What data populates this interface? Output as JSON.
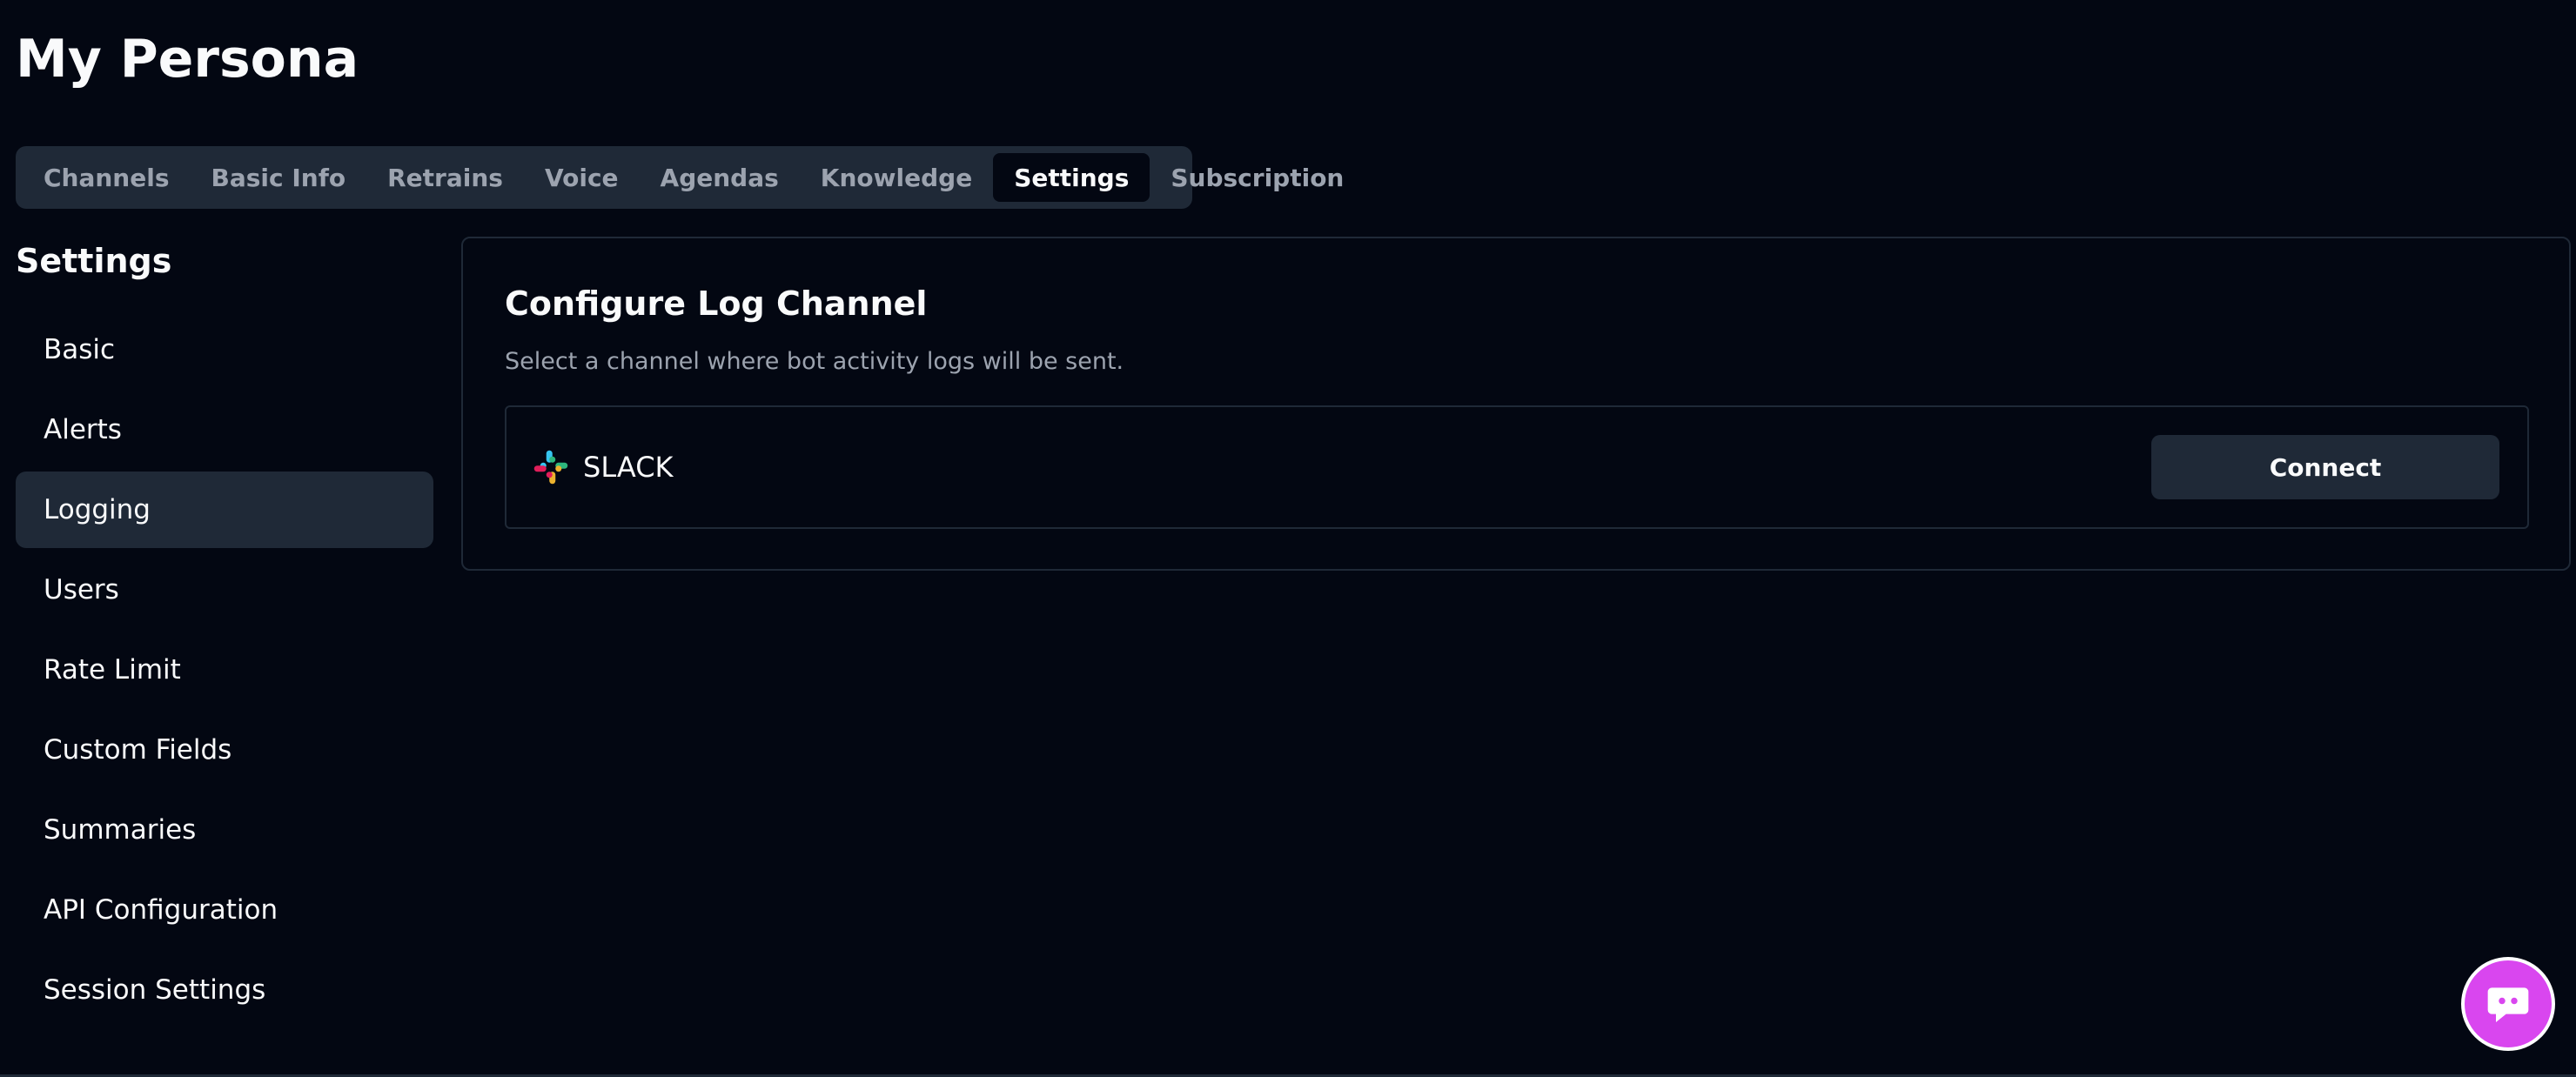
{
  "page": {
    "title": "My Persona"
  },
  "tabs": [
    {
      "label": "Channels",
      "active": false
    },
    {
      "label": "Basic Info",
      "active": false
    },
    {
      "label": "Retrains",
      "active": false
    },
    {
      "label": "Voice",
      "active": false
    },
    {
      "label": "Agendas",
      "active": false
    },
    {
      "label": "Knowledge",
      "active": false
    },
    {
      "label": "Settings",
      "active": true
    },
    {
      "label": "Subscription",
      "active": false
    }
  ],
  "sidebar": {
    "title": "Settings",
    "items": [
      {
        "label": "Basic",
        "active": false
      },
      {
        "label": "Alerts",
        "active": false
      },
      {
        "label": "Logging",
        "active": true
      },
      {
        "label": "Users",
        "active": false
      },
      {
        "label": "Rate Limit",
        "active": false
      },
      {
        "label": "Custom Fields",
        "active": false
      },
      {
        "label": "Summaries",
        "active": false
      },
      {
        "label": "API Configuration",
        "active": false
      },
      {
        "label": "Session Settings",
        "active": false
      }
    ]
  },
  "main": {
    "card": {
      "title": "Configure Log Channel",
      "description": "Select a channel where bot activity logs will be sent.",
      "channel": {
        "icon": "slack-icon",
        "name": "SLACK",
        "button_label": "Connect"
      }
    }
  },
  "chat_widget": {
    "icon": "chat-bubble-icon"
  },
  "colors": {
    "background": "#030712",
    "surface": "#1f2937",
    "text_primary": "#f9fafb",
    "text_muted": "#9ca3af",
    "accent": "#d946ef",
    "slack_red": "#e01e5a",
    "slack_blue": "#36c5f0",
    "slack_green": "#2eb67d",
    "slack_yellow": "#ecb22e"
  }
}
